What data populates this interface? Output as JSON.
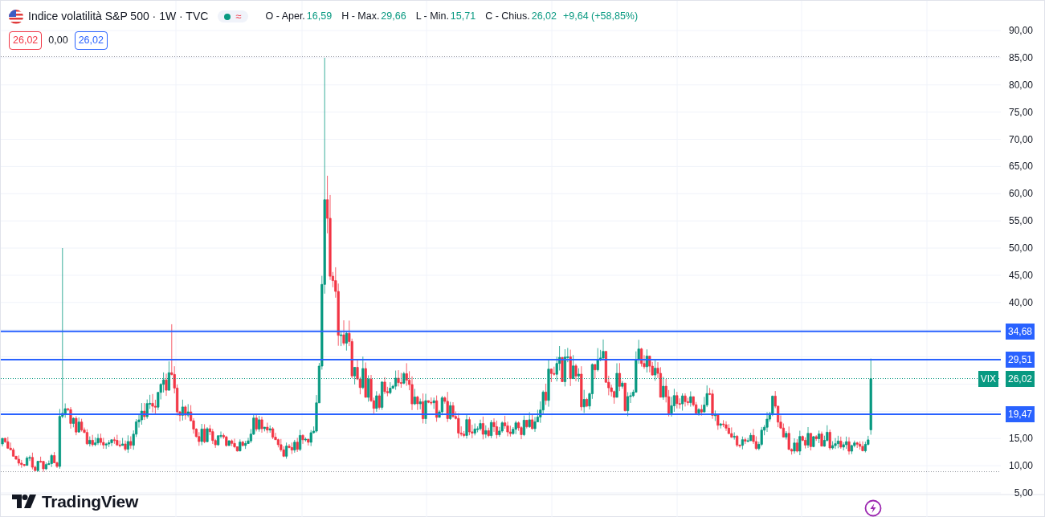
{
  "legend": {
    "title": "Indice volatilità S&P 500 · 1W · TVC",
    "status_symbol": "≈",
    "ohlc": [
      {
        "label": "O - Aper.",
        "value": "16,59"
      },
      {
        "label": "H - Max.",
        "value": "29,66"
      },
      {
        "label": "L - Min.",
        "value": "15,71"
      },
      {
        "label": "C - Chius.",
        "value": "26,02"
      }
    ],
    "change": "+9,64 (+58,85%)",
    "quotes": [
      {
        "kind": "sell",
        "text": "26,02"
      },
      {
        "kind": "spread",
        "text": "0,00"
      },
      {
        "kind": "buy",
        "text": "26,02"
      }
    ]
  },
  "price_axis": {
    "labels": [
      "90,00",
      "85,00",
      "80,00",
      "75,00",
      "70,00",
      "65,00",
      "60,00",
      "55,00",
      "50,00",
      "45,00",
      "40,00",
      "15,00",
      "10,00",
      "5,00"
    ]
  },
  "levels": [
    {
      "label": "34,68"
    },
    {
      "label": "29,51"
    },
    {
      "label": "19,47"
    }
  ],
  "last_price": {
    "symbol": "VIX",
    "price": "26,02"
  },
  "logo": {
    "text": "TradingView"
  }
}
